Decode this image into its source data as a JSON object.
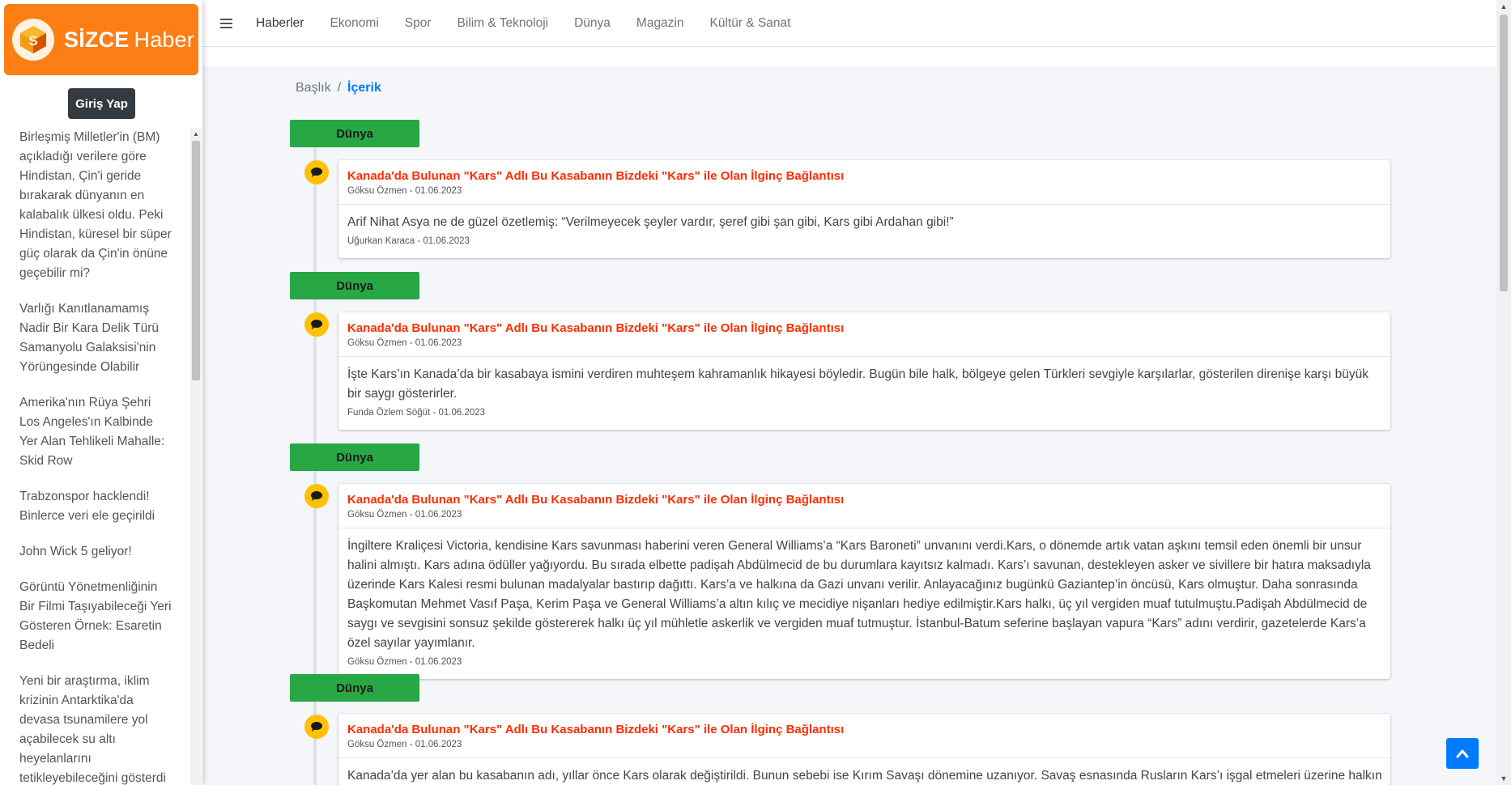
{
  "brand": {
    "name_bold": "SİZCE",
    "name_light": "Haber",
    "color": "#fd7e14"
  },
  "sidebar": {
    "login_label": "Giriş Yap",
    "news": [
      "Birleşmiş Milletler'in (BM) açıkladığı verilere göre Hindistan, Çin'i geride bırakarak dünyanın en kalabalık ülkesi oldu. Peki Hindistan, küresel bir süper güç olarak da Çin'in önüne geçebilir mi?",
      "Varlığı Kanıtlanamamış Nadir Bir Kara Delik Türü Samanyolu Galaksisi'nin Yörüngesinde Olabilir",
      "Amerika'nın Rüya Şehri Los Angeles'ın Kalbinde Yer Alan Tehlikeli Mahalle: Skid Row",
      "Trabzonspor hacklendi! Binlerce veri ele geçirildi",
      "John Wick 5 geliyor!",
      "Görüntü Yönetmenliğinin Bir Filmi Taşıyabileceği Yeri Gösteren Örnek: Esaretin Bedeli",
      "Yeni bir araştırma, iklim krizinin Antarktika'da devasa tsunamilere yol açabilecek su altı heyelanlarını tetikleyebileceğini gösterdi"
    ]
  },
  "nav": {
    "menu_icon": "hamburger-icon",
    "items": [
      "Haberler",
      "Ekonomi",
      "Spor",
      "Bilim & Teknoloji",
      "Dünya",
      "Magazin",
      "Kültür & Sanat"
    ]
  },
  "breadcrumb": {
    "parent": "Başlık",
    "separator": "/",
    "current": "İçerik"
  },
  "timeline": [
    {
      "category": "Dünya",
      "title": "Kanada'da Bulunan \"Kars\" Adlı Bu Kasabanın Bizdeki \"Kars\" ile Olan İlginç Bağlantısı",
      "author_date": "Göksu Özmen - 01.06.2023",
      "body": "Arif Nihat Asya ne de güzel özetlemiş: “Verilmeyecek şeyler vardır, şeref gibi şan gibi, Kars gibi Ardahan gibi!”",
      "body_meta": "Uğurkan Karaca - 01.06.2023"
    },
    {
      "category": "Dünya",
      "title": "Kanada'da Bulunan \"Kars\" Adlı Bu Kasabanın Bizdeki \"Kars\" ile Olan İlginç Bağlantısı",
      "author_date": "Göksu Özmen - 01.06.2023",
      "body": "İşte Kars’ın Kanada’da bir kasabaya ismini verdiren muhteşem kahramanlık hikayesi böyledir. Bugün bile halk, bölgeye gelen Türkleri sevgiyle karşılarlar, gösterilen direnişe karşı büyük bir saygı gösterirler.",
      "body_meta": "Funda Özlem Söğüt - 01.06.2023"
    },
    {
      "category": "Dünya",
      "title": "Kanada'da Bulunan \"Kars\" Adlı Bu Kasabanın Bizdeki \"Kars\" ile Olan İlginç Bağlantısı",
      "author_date": "Göksu Özmen - 01.06.2023",
      "body": "İngiltere Kraliçesi Victoria, kendisine Kars savunması haberini veren General Williams’a “Kars Baroneti” unvanını verdi.Kars, o dönemde artık vatan aşkını temsil eden önemli bir unsur halini almıştı. Kars adına ödüller yağıyordu. Bu sırada elbette padişah Abdülmecid de bu durumlara kayıtsız kalmadı. Kars’ı savunan, destekleyen asker ve sivillere bir hatıra maksadıyla üzerinde Kars Kalesi resmi bulunan madalyalar bastırıp dağıttı. Kars’a ve halkına da Gazi unvanı verilir. Anlayacağınız bugünkü Gaziantep’in öncüsü, Kars olmuştur. Daha sonrasında Başkomutan Mehmet Vasıf Paşa, Kerim Paşa ve General Williams’a altın kılıç ve mecidiye nişanları hediye edilmiştir.Kars halkı, üç yıl vergiden muaf tutulmuştu.Padişah Abdülmecid de saygı ve sevgisini sonsuz şekilde göstererek halkı üç yıl mühletle askerlik ve vergiden muaf tutmuştur. İstanbul-Batum seferine başlayan vapura “Kars” adını verdirir, gazetelerde Kars’a özel sayılar yayımlanır.",
      "body_meta": "Göksu Özmen - 01.06.2023"
    },
    {
      "category": "Dünya",
      "title": "Kanada'da Bulunan \"Kars\" Adlı Bu Kasabanın Bizdeki \"Kars\" ile Olan İlginç Bağlantısı",
      "author_date": "Göksu Özmen - 01.06.2023",
      "body": "Kanada’da yer alan bu kasabanın adı, yıllar önce Kars olarak değiştirildi. Bunun sebebi ise Kırım Savaşı dönemine uzanıyor. Savaş esnasında Rusların Kars’ı işgal etmeleri üzerine halkın büyük",
      "body_meta": ""
    }
  ],
  "colors": {
    "category_badge": "#28a745",
    "title_link": "#ff2d00",
    "timeline_icon": "#ffc107",
    "back_to_top": "#007bff"
  },
  "icons": {
    "timeline_icon": "comment-icon",
    "back_to_top": "chevron-up-icon"
  }
}
